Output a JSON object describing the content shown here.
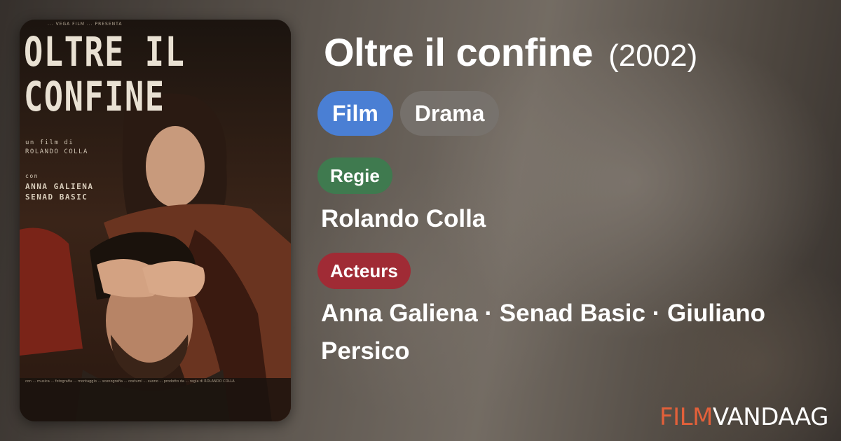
{
  "movie": {
    "title": "Oltre il confine",
    "year": "(2002)",
    "tags": [
      "Film",
      "Drama"
    ]
  },
  "credits": {
    "regie_label": "Regie",
    "regie_value": "Rolando Colla",
    "acteurs_label": "Acteurs",
    "acteurs_value": "Anna Galiena · Senad Basic · Giuliano Persico"
  },
  "poster": {
    "top_small": "... VEGA FILM ... PRESENTA",
    "title_line1": "OLTRE IL",
    "title_line2": "CONFINE",
    "credit_line1": "un film di",
    "credit_line2": "ROLANDO COLLA",
    "cast_con": "con",
    "cast_1": "ANNA GALIENA",
    "cast_2": "SENAD BASIC",
    "bottom_text": "con ... musica ... fotografia ... montaggio ... scenografia ... costumi ... suono ... prodotto da ... regia di ROLANDO COLLA"
  },
  "brand": {
    "part1": "FILM",
    "part2": "VANDAAG"
  },
  "colors": {
    "film_tag": "#4a7fd4",
    "genre_tag": "#78736e",
    "regie_label": "#3f7a4f",
    "acteurs_label": "#a02b35",
    "brand_accent": "#e2603a"
  }
}
